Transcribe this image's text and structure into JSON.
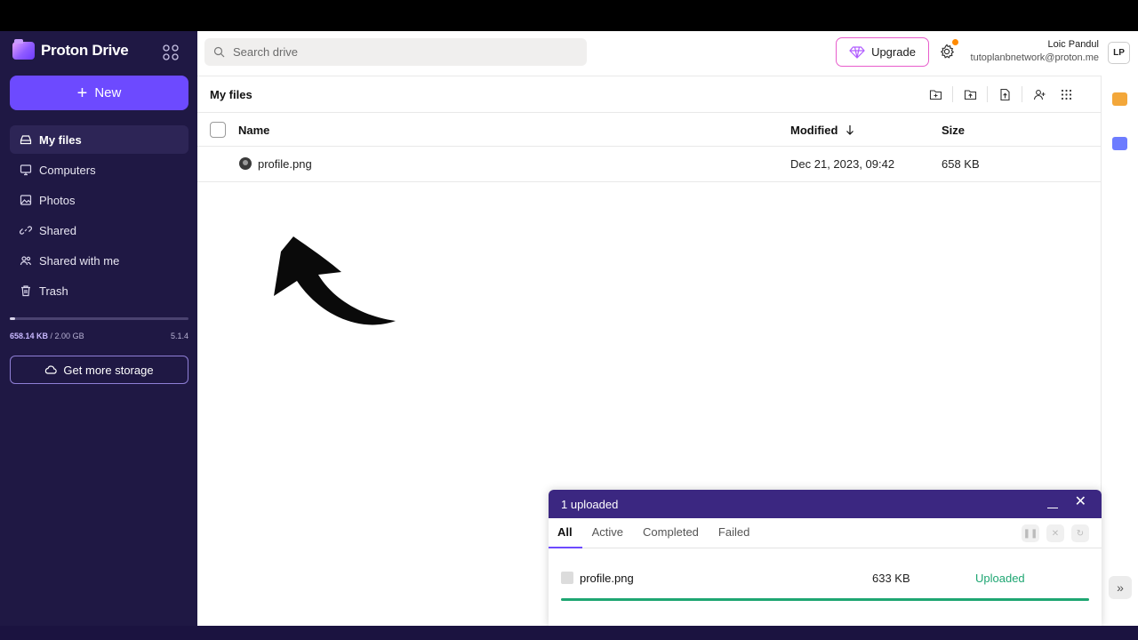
{
  "app": {
    "name": "Proton Drive"
  },
  "sidebar": {
    "new_label": "New",
    "items": [
      {
        "label": "My files",
        "icon": "drive-icon"
      },
      {
        "label": "Computers",
        "icon": "computer-icon"
      },
      {
        "label": "Photos",
        "icon": "image-icon"
      },
      {
        "label": "Shared",
        "icon": "link-icon"
      },
      {
        "label": "Shared with me",
        "icon": "users-icon"
      },
      {
        "label": "Trash",
        "icon": "trash-icon"
      }
    ],
    "storage_used": "658.14 KB",
    "storage_total": "/ 2.00 GB",
    "storage_fraction": 0.0003,
    "version": "5.1.4",
    "get_storage_label": "Get more storage"
  },
  "header": {
    "search_placeholder": "Search drive",
    "upgrade_label": "Upgrade",
    "user_name": "Loic Pandul",
    "user_email": "tutoplanbnetwork@proton.me",
    "user_initials": "LP"
  },
  "main": {
    "title": "My files",
    "columns": {
      "name": "Name",
      "modified": "Modified",
      "size": "Size"
    },
    "rows": [
      {
        "name": "profile.png",
        "modified": "Dec 21, 2023, 09:42",
        "size": "658 KB"
      }
    ]
  },
  "upload": {
    "title": "1 uploaded",
    "tabs": [
      "All",
      "Active",
      "Completed",
      "Failed"
    ],
    "items": [
      {
        "name": "profile.png",
        "size": "633 KB",
        "status": "Uploaded",
        "progress": 1.0
      }
    ]
  },
  "colors": {
    "accent": "#6d4aff",
    "sidebar_bg": "#1f1844",
    "success": "#1ea672",
    "upload_header": "#3b2781"
  }
}
